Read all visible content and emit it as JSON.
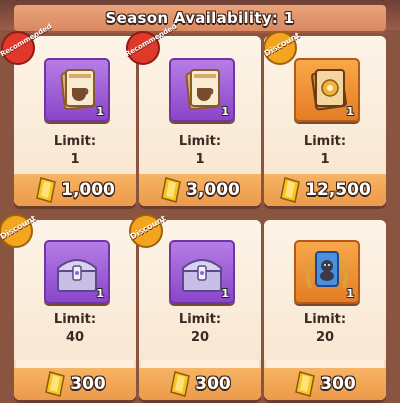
{
  "header": {
    "title": "Season Availability: 1"
  },
  "badges": {
    "recommended": "Recommended",
    "discount": "Discount"
  },
  "cards": [
    {
      "item": "coffee-card-pack",
      "qty": "1",
      "limit_label": "Limit:",
      "limit": "1",
      "price": "1,000",
      "badge": "recommended",
      "frame": "purple"
    },
    {
      "item": "coffee-card-pack",
      "qty": "1",
      "limit_label": "Limit:",
      "limit": "1",
      "price": "3,000",
      "badge": "recommended",
      "frame": "purple"
    },
    {
      "item": "gold-card-pack",
      "qty": "1",
      "limit_label": "Limit:",
      "limit": "1",
      "price": "12,500",
      "badge": "discount",
      "frame": "orange"
    },
    {
      "item": "silver-chest",
      "qty": "1",
      "limit_label": "Limit:",
      "limit": "40",
      "price": "300",
      "badge": "discount",
      "frame": "purple"
    },
    {
      "item": "silver-chest",
      "qty": "1",
      "limit_label": "Limit:",
      "limit": "20",
      "price": "300",
      "badge": "discount",
      "frame": "purple"
    },
    {
      "item": "gorilla-card",
      "qty": "1",
      "limit_label": "Limit:",
      "limit": "20",
      "price": "300",
      "badge": "none",
      "frame": "orange"
    }
  ],
  "colors": {
    "recommended_badge": "#e0392b",
    "discount_badge": "#f3a51f",
    "gem": "#f7c51e"
  }
}
